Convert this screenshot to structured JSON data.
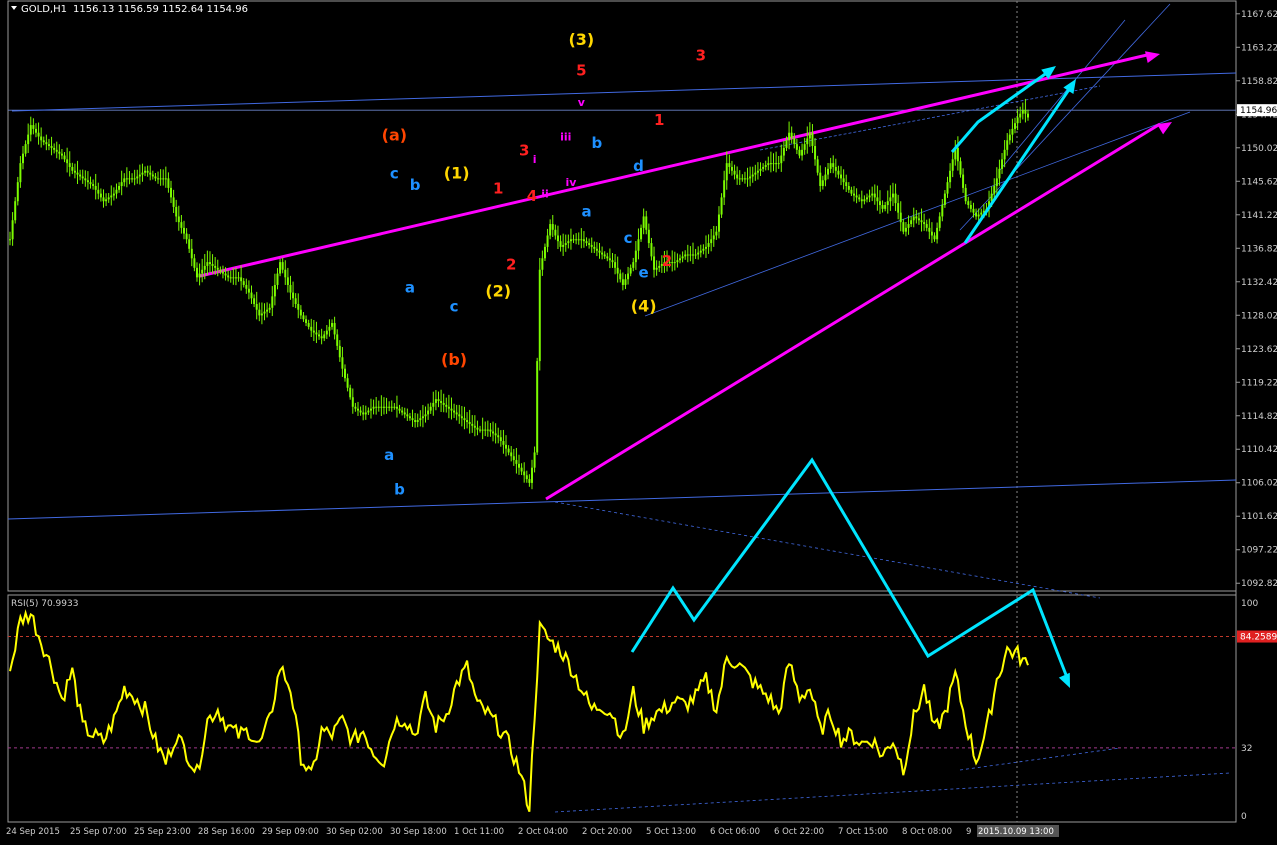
{
  "header": {
    "symbol": "GOLD,H1",
    "ohlc": "1156.13 1156.59 1152.64 1154.96"
  },
  "indicator": {
    "label": "RSI(5) 70.9933",
    "levels": {
      "top": "100",
      "marker": "84.2589",
      "low": "32",
      "bottom": "0"
    }
  },
  "colors": {
    "background": "#000000",
    "candle": "#7cfc00",
    "rsi": "#ffff00",
    "channel": "#ff00ff",
    "trendline": "#4169e1",
    "arrow": "#00e5ff",
    "count_red": "#ff2020",
    "count_blue": "#1e90ff",
    "count_yellow": "#ffd700",
    "count_orange": "#ff4500",
    "count_magenta": "#ff00ff"
  },
  "chart_data": {
    "type": "candlestick",
    "price_axis": {
      "ticks": [
        "1167.62",
        "1163.22",
        "1158.82",
        "1154.42",
        "1150.02",
        "1145.62",
        "1141.22",
        "1136.82",
        "1132.42",
        "1128.02",
        "1123.62",
        "1119.22",
        "1114.82",
        "1110.42",
        "1106.02",
        "1101.62",
        "1097.22",
        "1092.82"
      ],
      "current_price": "1154.96",
      "range": [
        1091.8,
        1169.3
      ]
    },
    "time_axis": {
      "labels": [
        "24 Sep 2015",
        "25 Sep 07:00",
        "25 Sep 23:00",
        "28 Sep 16:00",
        "29 Sep 09:00",
        "30 Sep 02:00",
        "30 Sep 18:00",
        "1 Oct 11:00",
        "2 Oct 04:00",
        "2 Oct 20:00",
        "5 Oct 13:00",
        "6 Oct 06:00",
        "6 Oct 22:00",
        "7 Oct 15:00",
        "8 Oct 08:00",
        "9",
        "2015.10.09 13:00"
      ]
    },
    "price_path": [
      [
        0,
        1138
      ],
      [
        2,
        1148
      ],
      [
        4,
        1153
      ],
      [
        6,
        1151
      ],
      [
        8,
        1150
      ],
      [
        10,
        1149
      ],
      [
        12,
        1147
      ],
      [
        14,
        1146
      ],
      [
        16,
        1145
      ],
      [
        18,
        1143
      ],
      [
        20,
        1144
      ],
      [
        22,
        1146
      ],
      [
        24,
        1146
      ],
      [
        26,
        1147
      ],
      [
        28,
        1146
      ],
      [
        30,
        1146
      ],
      [
        32,
        1141
      ],
      [
        34,
        1138
      ],
      [
        36,
        1133
      ],
      [
        38,
        1135
      ],
      [
        40,
        1134
      ],
      [
        42,
        1133
      ],
      [
        44,
        1133
      ],
      [
        46,
        1131
      ],
      [
        48,
        1128
      ],
      [
        50,
        1129
      ],
      [
        52,
        1135
      ],
      [
        54,
        1131
      ],
      [
        56,
        1128
      ],
      [
        58,
        1126
      ],
      [
        60,
        1125
      ],
      [
        62,
        1127
      ],
      [
        64,
        1121
      ],
      [
        66,
        1116
      ],
      [
        68,
        1115
      ],
      [
        70,
        1116
      ],
      [
        72,
        1116
      ],
      [
        74,
        1116
      ],
      [
        76,
        1115
      ],
      [
        78,
        1114
      ],
      [
        80,
        1115
      ],
      [
        82,
        1117
      ],
      [
        84,
        1116
      ],
      [
        86,
        1115
      ],
      [
        88,
        1114
      ],
      [
        90,
        1113
      ],
      [
        92,
        1113
      ],
      [
        94,
        1112
      ],
      [
        96,
        1110
      ],
      [
        98,
        1108
      ],
      [
        100,
        1106
      ],
      [
        101,
        1110
      ],
      [
        102,
        1134
      ],
      [
        104,
        1140
      ],
      [
        106,
        1137
      ],
      [
        108,
        1138
      ],
      [
        110,
        1138
      ],
      [
        112,
        1137
      ],
      [
        114,
        1136
      ],
      [
        116,
        1135
      ],
      [
        118,
        1132
      ],
      [
        120,
        1135
      ],
      [
        122,
        1141
      ],
      [
        124,
        1134
      ],
      [
        126,
        1135
      ],
      [
        128,
        1135
      ],
      [
        130,
        1136
      ],
      [
        132,
        1136
      ],
      [
        134,
        1137
      ],
      [
        136,
        1139
      ],
      [
        138,
        1148
      ],
      [
        140,
        1146
      ],
      [
        142,
        1146
      ],
      [
        144,
        1147
      ],
      [
        146,
        1148
      ],
      [
        148,
        1148
      ],
      [
        150,
        1152
      ],
      [
        152,
        1149
      ],
      [
        154,
        1152
      ],
      [
        156,
        1145
      ],
      [
        158,
        1148
      ],
      [
        160,
        1146
      ],
      [
        162,
        1144
      ],
      [
        164,
        1143
      ],
      [
        166,
        1144
      ],
      [
        168,
        1142
      ],
      [
        170,
        1144
      ],
      [
        172,
        1139
      ],
      [
        174,
        1141
      ],
      [
        176,
        1140
      ],
      [
        178,
        1138
      ],
      [
        180,
        1144
      ],
      [
        182,
        1150
      ],
      [
        184,
        1143
      ],
      [
        186,
        1141
      ],
      [
        188,
        1142
      ],
      [
        190,
        1146
      ],
      [
        192,
        1151
      ],
      [
        194,
        1154
      ],
      [
        195,
        1155
      ],
      [
        196,
        1154
      ]
    ],
    "rsi_path": [
      [
        0,
        68
      ],
      [
        2,
        92
      ],
      [
        4,
        95
      ],
      [
        6,
        82
      ],
      [
        8,
        70
      ],
      [
        10,
        55
      ],
      [
        12,
        68
      ],
      [
        14,
        42
      ],
      [
        16,
        38
      ],
      [
        18,
        35
      ],
      [
        20,
        45
      ],
      [
        22,
        60
      ],
      [
        24,
        56
      ],
      [
        26,
        50
      ],
      [
        28,
        35
      ],
      [
        30,
        25
      ],
      [
        32,
        38
      ],
      [
        34,
        30
      ],
      [
        36,
        20
      ],
      [
        38,
        45
      ],
      [
        40,
        50
      ],
      [
        42,
        42
      ],
      [
        44,
        38
      ],
      [
        46,
        40
      ],
      [
        48,
        33
      ],
      [
        50,
        45
      ],
      [
        52,
        70
      ],
      [
        54,
        60
      ],
      [
        56,
        28
      ],
      [
        58,
        18
      ],
      [
        60,
        40
      ],
      [
        62,
        38
      ],
      [
        64,
        45
      ],
      [
        66,
        35
      ],
      [
        68,
        40
      ],
      [
        70,
        30
      ],
      [
        72,
        26
      ],
      [
        74,
        44
      ],
      [
        76,
        46
      ],
      [
        78,
        38
      ],
      [
        80,
        55
      ],
      [
        82,
        42
      ],
      [
        84,
        48
      ],
      [
        86,
        62
      ],
      [
        88,
        70
      ],
      [
        90,
        52
      ],
      [
        92,
        48
      ],
      [
        94,
        42
      ],
      [
        96,
        34
      ],
      [
        98,
        22
      ],
      [
        100,
        4
      ],
      [
        101,
        48
      ],
      [
        102,
        88
      ],
      [
        104,
        82
      ],
      [
        106,
        78
      ],
      [
        108,
        70
      ],
      [
        110,
        60
      ],
      [
        112,
        50
      ],
      [
        114,
        52
      ],
      [
        116,
        48
      ],
      [
        118,
        36
      ],
      [
        120,
        58
      ],
      [
        122,
        42
      ],
      [
        124,
        48
      ],
      [
        126,
        50
      ],
      [
        128,
        54
      ],
      [
        130,
        52
      ],
      [
        132,
        56
      ],
      [
        134,
        64
      ],
      [
        136,
        50
      ],
      [
        138,
        74
      ],
      [
        140,
        72
      ],
      [
        142,
        66
      ],
      [
        144,
        60
      ],
      [
        146,
        56
      ],
      [
        148,
        48
      ],
      [
        150,
        72
      ],
      [
        152,
        56
      ],
      [
        154,
        60
      ],
      [
        156,
        40
      ],
      [
        158,
        48
      ],
      [
        160,
        36
      ],
      [
        162,
        38
      ],
      [
        164,
        34
      ],
      [
        166,
        36
      ],
      [
        168,
        28
      ],
      [
        170,
        36
      ],
      [
        172,
        22
      ],
      [
        174,
        46
      ],
      [
        176,
        60
      ],
      [
        178,
        40
      ],
      [
        180,
        48
      ],
      [
        182,
        66
      ],
      [
        184,
        44
      ],
      [
        186,
        26
      ],
      [
        188,
        40
      ],
      [
        190,
        64
      ],
      [
        192,
        78
      ],
      [
        194,
        76
      ],
      [
        196,
        70
      ]
    ],
    "wave_labels": [
      {
        "text": "(a)",
        "color": "count_orange",
        "i": 74,
        "p": 1151
      },
      {
        "text": "c",
        "color": "count_blue",
        "i": 74,
        "p": 1146
      },
      {
        "text": "b",
        "color": "count_blue",
        "i": 78,
        "p": 1144.5
      },
      {
        "text": "(1)",
        "color": "count_yellow",
        "i": 86,
        "p": 1146
      },
      {
        "text": "1",
        "color": "count_red",
        "i": 94,
        "p": 1144
      },
      {
        "text": "3",
        "color": "count_red",
        "i": 99,
        "p": 1149
      },
      {
        "text": "4",
        "color": "count_red",
        "i": 100.5,
        "p": 1143
      },
      {
        "text": "ii",
        "color": "count_magenta",
        "i": 103,
        "p": 1143.5
      },
      {
        "text": "i",
        "color": "count_magenta",
        "i": 101,
        "p": 1148
      },
      {
        "text": "iii",
        "color": "count_magenta",
        "i": 107,
        "p": 1151
      },
      {
        "text": "(3)",
        "color": "count_yellow",
        "i": 110,
        "p": 1163.5
      },
      {
        "text": "5",
        "color": "count_red",
        "i": 110,
        "p": 1159.5
      },
      {
        "text": "v",
        "color": "count_magenta",
        "i": 110,
        "p": 1155.5
      },
      {
        "text": "iv",
        "color": "count_magenta",
        "i": 108,
        "p": 1145
      },
      {
        "text": "b",
        "color": "count_blue",
        "i": 113,
        "p": 1150
      },
      {
        "text": "a",
        "color": "count_blue",
        "i": 111,
        "p": 1141
      },
      {
        "text": "d",
        "color": "count_blue",
        "i": 121,
        "p": 1147
      },
      {
        "text": "c",
        "color": "count_blue",
        "i": 119,
        "p": 1137.5
      },
      {
        "text": "e",
        "color": "count_blue",
        "i": 122,
        "p": 1133
      },
      {
        "text": "(4)",
        "color": "count_yellow",
        "i": 122,
        "p": 1128.5
      },
      {
        "text": "1",
        "color": "count_red",
        "i": 125,
        "p": 1153
      },
      {
        "text": "2",
        "color": "count_red",
        "i": 126.5,
        "p": 1134.5
      },
      {
        "text": "3",
        "color": "count_red",
        "i": 133,
        "p": 1161.5
      },
      {
        "text": "2",
        "color": "count_red",
        "i": 96.5,
        "p": 1134
      },
      {
        "text": "(2)",
        "color": "count_yellow",
        "i": 94,
        "p": 1130.5
      },
      {
        "text": "c",
        "color": "count_blue",
        "i": 85.5,
        "p": 1128.5
      },
      {
        "text": "(b)",
        "color": "count_orange",
        "i": 85.5,
        "p": 1121.5
      },
      {
        "text": "a",
        "color": "count_blue",
        "i": 77,
        "p": 1131
      },
      {
        "text": "a",
        "color": "count_blue",
        "i": 73,
        "p": 1109
      },
      {
        "text": "b",
        "color": "count_blue",
        "i": 75,
        "p": 1104.5
      }
    ]
  }
}
